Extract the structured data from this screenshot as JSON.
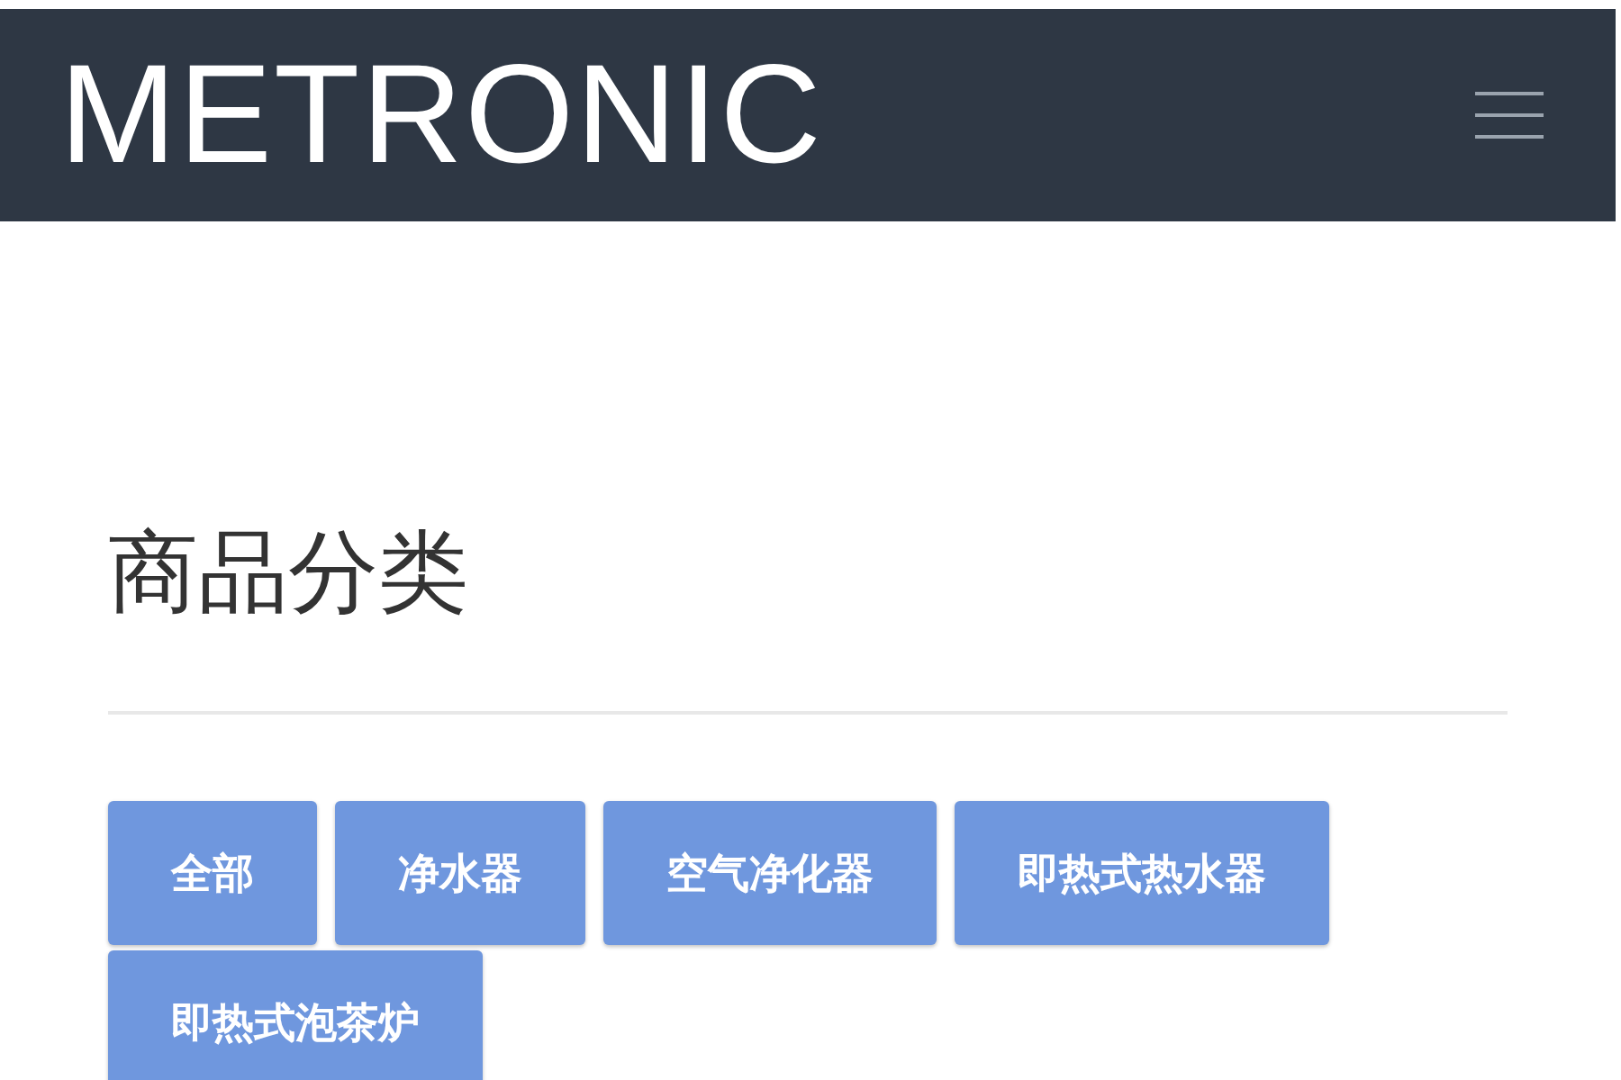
{
  "header": {
    "logo": "METRONIC"
  },
  "section": {
    "title": "商品分类"
  },
  "categories": [
    {
      "label": "全部",
      "selected": false
    },
    {
      "label": "净水器",
      "selected": false
    },
    {
      "label": "空气净化器",
      "selected": false
    },
    {
      "label": "即热式热水器",
      "selected": false
    },
    {
      "label": "即热式泡茶炉",
      "selected": false
    }
  ]
}
